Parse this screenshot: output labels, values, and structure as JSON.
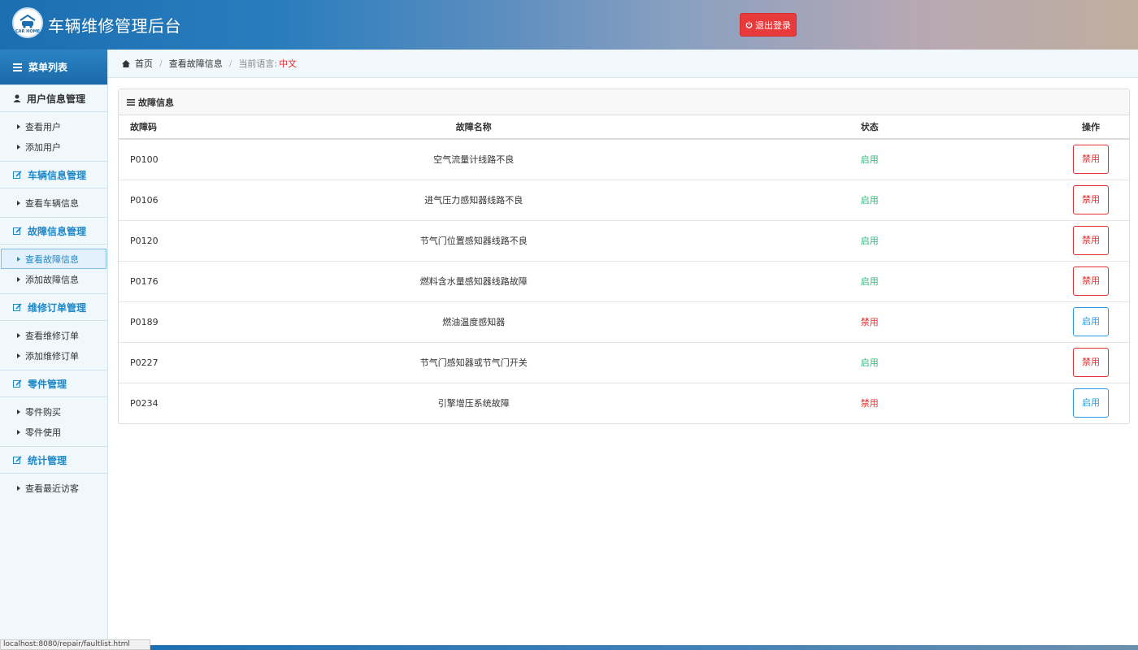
{
  "header": {
    "title": "车辆维修管理后台",
    "logo_text": "CAR HOME",
    "logout_label": "退出登录"
  },
  "sidebar": {
    "menu_title": "菜单列表",
    "groups": [
      {
        "label": "用户信息管理",
        "items": [
          "查看用户",
          "添加用户"
        ]
      },
      {
        "label": "车辆信息管理",
        "items": [
          "查看车辆信息"
        ]
      },
      {
        "label": "故障信息管理",
        "items": [
          "查看故障信息",
          "添加故障信息"
        ]
      },
      {
        "label": "维修订单管理",
        "items": [
          "查看维修订单",
          "添加维修订单"
        ]
      },
      {
        "label": "零件管理",
        "items": [
          "零件购买",
          "零件使用"
        ]
      },
      {
        "label": "统计管理",
        "items": [
          "查看最近访客"
        ]
      }
    ],
    "active_item": "查看故障信息"
  },
  "breadcrumb": {
    "home": "首页",
    "current": "查看故障信息",
    "lang_label": "当前语言:",
    "lang_value": "中文"
  },
  "panel": {
    "title": "故障信息",
    "columns": [
      "故障码",
      "故障名称",
      "状态",
      "操作"
    ],
    "rows": [
      {
        "code": "P0100",
        "name": "空气流量计线路不良",
        "status": "启用",
        "action": "禁用"
      },
      {
        "code": "P0106",
        "name": "进气压力感知器线路不良",
        "status": "启用",
        "action": "禁用"
      },
      {
        "code": "P0120",
        "name": "节气门位置感知器线路不良",
        "status": "启用",
        "action": "禁用"
      },
      {
        "code": "P0176",
        "name": "燃料含水量感知器线路故障",
        "status": "启用",
        "action": "禁用"
      },
      {
        "code": "P0189",
        "name": "燃油温度感知器",
        "status": "禁用",
        "action": "启用"
      },
      {
        "code": "P0227",
        "name": "节气门感知器或节气门开关",
        "status": "启用",
        "action": "禁用"
      },
      {
        "code": "P0234",
        "name": "引擎增压系统故障",
        "status": "禁用",
        "action": "启用"
      }
    ]
  },
  "statusbar": {
    "url": "localhost:8080/repair/faultlist.html"
  },
  "colors": {
    "enabled": "#2fb67e",
    "disabled": "#e0302f",
    "primary": "#1e88c8",
    "logout": "#e8393b"
  }
}
